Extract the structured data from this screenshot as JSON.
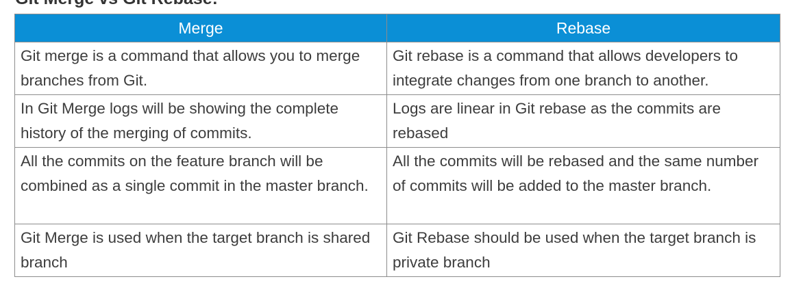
{
  "heading": "Git Merge vs Git Rebase:",
  "table": {
    "headers": [
      "Merge",
      "Rebase"
    ],
    "rows": [
      [
        "Git merge is a command that allows you to merge branches from Git.",
        "Git rebase is a command that allows developers to integrate changes from one branch to another."
      ],
      [
        "In Git Merge logs will be showing the complete history of the merging of commits.",
        "Logs are linear in Git rebase as the commits are rebased"
      ],
      [
        "All the commits on the feature branch will be combined as a single commit in the master branch.",
        "All the commits will be rebased and the same number of commits will be added to the master branch."
      ],
      [
        "Git Merge is used when the target branch is shared branch",
        "Git Rebase should be used when the target branch is private branch"
      ]
    ]
  }
}
